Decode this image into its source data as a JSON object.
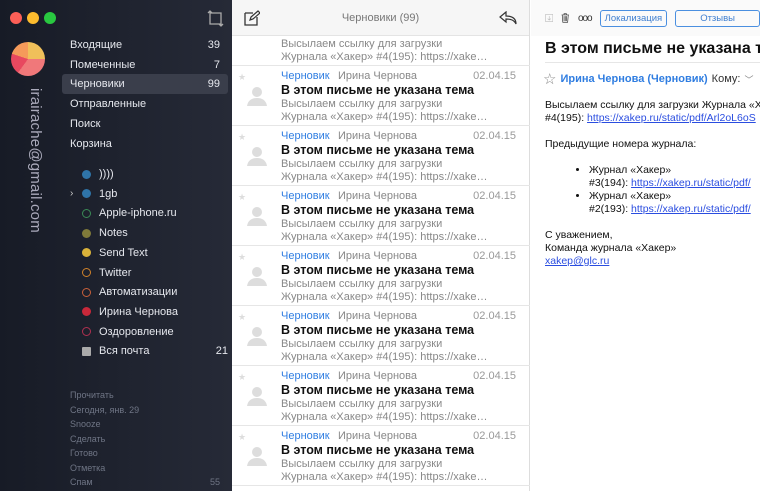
{
  "account": {
    "email": "irairache@gmail.com"
  },
  "folders": [
    {
      "label": "Входящие",
      "count": "39"
    },
    {
      "label": "Помеченные",
      "count": "7"
    },
    {
      "label": "Черновики",
      "count": "99",
      "selected": true
    },
    {
      "label": "Отправленные",
      "count": ""
    },
    {
      "label": "Поиск",
      "count": ""
    },
    {
      "label": "Корзина",
      "count": ""
    }
  ],
  "tags": [
    {
      "label": "))))",
      "color": "#2f74a8",
      "filled": true
    },
    {
      "label": "1gb",
      "color": "#2f74a8",
      "filled": true,
      "expand": true
    },
    {
      "label": "Apple-iphone.ru",
      "color": "#3a8a55",
      "filled": false
    },
    {
      "label": "Notes",
      "color": "#7f7a3a",
      "filled": true
    },
    {
      "label": "Send Text",
      "color": "#d9b23a",
      "filled": true
    },
    {
      "label": "Twitter",
      "color": "#d0822a",
      "filled": false
    },
    {
      "label": "Автоматизации",
      "color": "#c9603a",
      "filled": false
    },
    {
      "label": "Ирина Чернова",
      "color": "#c8283a",
      "filled": true
    },
    {
      "label": "Оздоровление",
      "color": "#b03050",
      "filled": false
    },
    {
      "label": "Вся почта",
      "count": "21",
      "archive": true
    }
  ],
  "smart": [
    {
      "label": "Прочитать",
      "count": ""
    },
    {
      "label": "Сегодня, янв. 29",
      "count": ""
    },
    {
      "label": "Snooze",
      "count": ""
    },
    {
      "label": "Сделать",
      "count": ""
    },
    {
      "label": "Готово",
      "count": ""
    },
    {
      "label": "Отметка",
      "count": ""
    },
    {
      "label": "Спам",
      "count": "55"
    }
  ],
  "list": {
    "title": "Черновики (99)",
    "first_preview": [
      "Высылаем ссылку для загрузки",
      "Журнала «Хакер» #4(195): https://xake…"
    ],
    "items": [
      {
        "label": "Черновик",
        "from": "Ирина Чернова",
        "date": "02.04.15",
        "subject": "В этом письме не указана тема",
        "p1": "Высылаем ссылку для загрузки",
        "p2": "Журнала «Хакер» #4(195): https://xake…"
      },
      {
        "label": "Черновик",
        "from": "Ирина Чернова",
        "date": "02.04.15",
        "subject": "В этом письме не указана тема",
        "p1": "Высылаем ссылку для загрузки",
        "p2": "Журнала «Хакер» #4(195): https://xake…"
      },
      {
        "label": "Черновик",
        "from": "Ирина Чернова",
        "date": "02.04.15",
        "subject": "В этом письме не указана тема",
        "p1": "Высылаем ссылку для загрузки",
        "p2": "Журнала «Хакер» #4(195): https://xake…"
      },
      {
        "label": "Черновик",
        "from": "Ирина Чернова",
        "date": "02.04.15",
        "subject": "В этом письме не указана тема",
        "p1": "Высылаем ссылку для загрузки",
        "p2": "Журнала «Хакер» #4(195): https://xake…"
      },
      {
        "label": "Черновик",
        "from": "Ирина Чернова",
        "date": "02.04.15",
        "subject": "В этом письме не указана тема",
        "p1": "Высылаем ссылку для загрузки",
        "p2": "Журнала «Хакер» #4(195): https://xake…"
      },
      {
        "label": "Черновик",
        "from": "Ирина Чернова",
        "date": "02.04.15",
        "subject": "В этом письме не указана тема",
        "p1": "Высылаем ссылку для загрузки",
        "p2": "Журнала «Хакер» #4(195): https://xake…"
      },
      {
        "label": "Черновик",
        "from": "Ирина Чернова",
        "date": "02.04.15",
        "subject": "В этом письме не указана тема",
        "p1": "Высылаем ссылку для загрузки",
        "p2": "Журнала «Хакер» #4(195): https://xake…"
      }
    ]
  },
  "message": {
    "toolbar": {
      "tag1": "Локализация",
      "tag2": "Отзывы"
    },
    "subject": "В этом письме не указана тема",
    "from": "Ирина Чернова (Черновик)",
    "to_label": "Кому:",
    "line1": "Высылаем ссылку для загрузки Журнала «Хакер»",
    "line2_prefix": "#4(195): ",
    "link1": "https://xakep.ru/static/pdf/Arl2oL6oS",
    "prev_heading": "Предыдущие номера журнала:",
    "bullets": [
      {
        "title": "Журнал «Хакер»",
        "num": "#3(194): ",
        "link": "https://xakep.ru/static/pdf/"
      },
      {
        "title": "Журнал «Хакер»",
        "num": "#2(193): ",
        "link": "https://xakep.ru/static/pdf/"
      }
    ],
    "sign1": "С уважением,",
    "sign2": "Команда журнала «Хакер»",
    "sign_email": "xakep@glc.ru"
  }
}
